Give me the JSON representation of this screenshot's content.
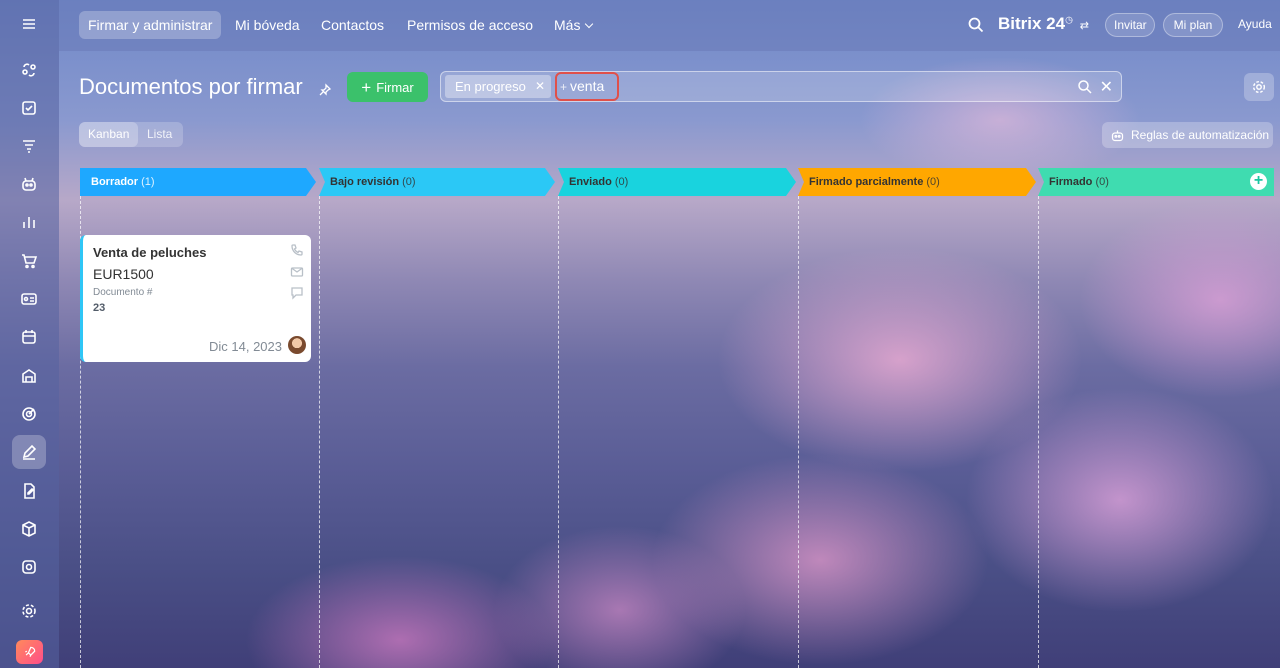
{
  "nav": {
    "tabs": [
      "Firmar y administrar",
      "Mi bóveda",
      "Contactos",
      "Permisos de acceso",
      "Más"
    ],
    "brand": "Bitrix 24",
    "invite": "Invitar",
    "plan": "Mi plan",
    "help": "Ayuda"
  },
  "page": {
    "title": "Documentos por firmar",
    "sign_button": "Firmar"
  },
  "filter": {
    "chip": "En progreso",
    "search_text": "venta",
    "plus": "+"
  },
  "views": {
    "kanban": "Kanban",
    "list": "Lista"
  },
  "automation": "Reglas de automatización",
  "columns": [
    {
      "name": "Borrador",
      "count": "(1)",
      "color": "#1ea8ff"
    },
    {
      "name": "Bajo revisión",
      "count": "(0)",
      "color": "#2bc8f6"
    },
    {
      "name": "Enviado",
      "count": "(0)",
      "color": "#19d3de"
    },
    {
      "name": "Firmado parcialmente",
      "count": "(0)",
      "color": "#ffa700"
    },
    {
      "name": "Firmado",
      "count": "(0)",
      "color": "#3fdcb0"
    }
  ],
  "card": {
    "title": "Venta de peluches",
    "amount": "EUR1500",
    "doc_label": "Documento #",
    "doc_number": "23",
    "date": "Dic 14, 2023",
    "accent": "#2fc6f6"
  }
}
